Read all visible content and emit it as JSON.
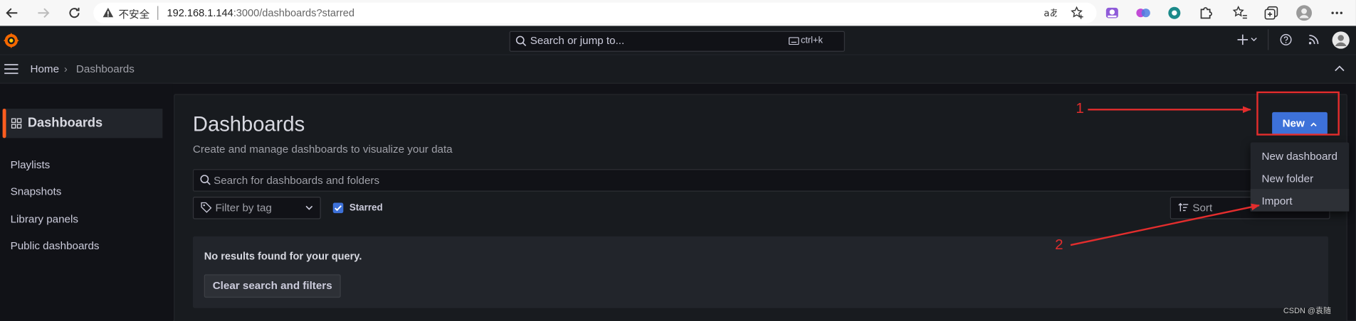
{
  "browser": {
    "security_label": "不安全",
    "url_host": "192.168.1.144",
    "url_rest": ":3000/dashboards?starred"
  },
  "topbar": {
    "search_placeholder": "Search or jump to...",
    "search_shortcut": "ctrl+k"
  },
  "breadcrumb": {
    "home": "Home",
    "separator": "›",
    "current": "Dashboards"
  },
  "sidebar": {
    "active_label": "Dashboards",
    "links": [
      "Playlists",
      "Snapshots",
      "Library panels",
      "Public dashboards"
    ]
  },
  "page": {
    "title": "Dashboards",
    "subtitle": "Create and manage dashboards to visualize your data",
    "search_placeholder": "Search for dashboards and folders",
    "tag_filter_placeholder": "Filter by tag",
    "starred_label": "Starred",
    "starred_checked": true,
    "sort_placeholder": "Sort",
    "empty_message": "No results found for your query.",
    "clear_button": "Clear search and filters"
  },
  "new_menu": {
    "button_label": "New",
    "items": [
      "New dashboard",
      "New folder",
      "Import"
    ],
    "highlighted": "Import"
  },
  "annotations": {
    "step1": "1",
    "step2": "2",
    "color": "#e32d2d"
  },
  "watermark": "CSDN @袁随",
  "colors": {
    "accent": "#3d71d9",
    "brand": "#ff5d1f",
    "background": "#111217",
    "panel": "#181b1f"
  }
}
